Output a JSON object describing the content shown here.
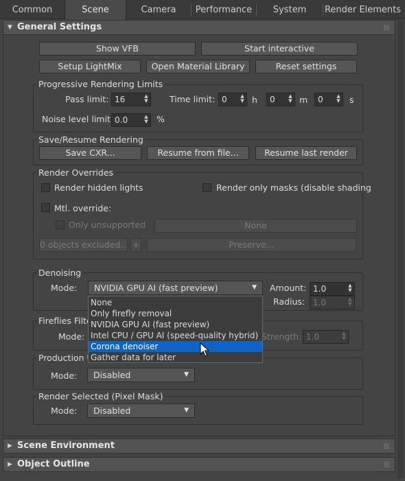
{
  "tabs": [
    "Common",
    "Scene",
    "Camera",
    "Performance",
    "System",
    "Render Elements"
  ],
  "active_tab": "Scene",
  "general": {
    "title": "General Settings",
    "buttons": {
      "show_vfb": "Show VFB",
      "start_interactive": "Start interactive",
      "setup_lightmix": "Setup LightMix",
      "open_material_library": "Open Material Library",
      "reset_settings": "Reset settings"
    },
    "progressive": {
      "title": "Progressive Rendering Limits",
      "pass_limit_label": "Pass limit:",
      "pass_limit": "16",
      "time_limit_label": "Time limit:",
      "hours": "0",
      "h": "h",
      "minutes": "0",
      "m": "m",
      "seconds": "0",
      "s": "s",
      "noise_label": "Noise level limit:",
      "noise": "0.0",
      "percent": "%"
    },
    "save_resume": {
      "title": "Save/Resume Rendering",
      "save": "Save CXR...",
      "resume_file": "Resume from file...",
      "resume_last": "Resume last render"
    },
    "overrides": {
      "title": "Render Overrides",
      "hidden_lights": "Render hidden lights",
      "only_masks": "Render only masks (disable shading",
      "mtl_override": "Mtl. override:",
      "only_unsupported": "Only unsupported",
      "none": "None",
      "excluded": "0 objects excluded...",
      "plus": "+",
      "preserve": "Preserve..."
    },
    "denoising": {
      "title": "Denoising",
      "mode_label": "Mode:",
      "mode_value": "NVIDIA GPU AI (fast preview)",
      "amount_label": "Amount:",
      "amount": "1.0",
      "radius_label": "Radius:",
      "radius": "1.0",
      "options": [
        "None",
        "Only firefly removal",
        "NVIDIA GPU AI (fast preview)",
        "Intel CPU / GPU AI (speed-quality hybrid)",
        "Corona denoiser",
        "Gather data for later"
      ],
      "highlighted": "Corona denoiser"
    },
    "fireflies": {
      "title": "Fireflies Filte",
      "mode_label": "Mode:",
      "strength_label": "Strength:",
      "strength": "1.0"
    },
    "production": {
      "title": "Production U",
      "mode_label": "Mode:",
      "mode_value": "Disabled"
    },
    "pixel_mask": {
      "title": "Render Selected (Pixel Mask)",
      "mode_label": "Mode:",
      "mode_value": "Disabled"
    }
  },
  "rollouts": {
    "scene_environment": "Scene Environment",
    "object_outline": "Object Outline"
  },
  "colors": {
    "background": "#444444",
    "highlight": "#0e63c7"
  }
}
